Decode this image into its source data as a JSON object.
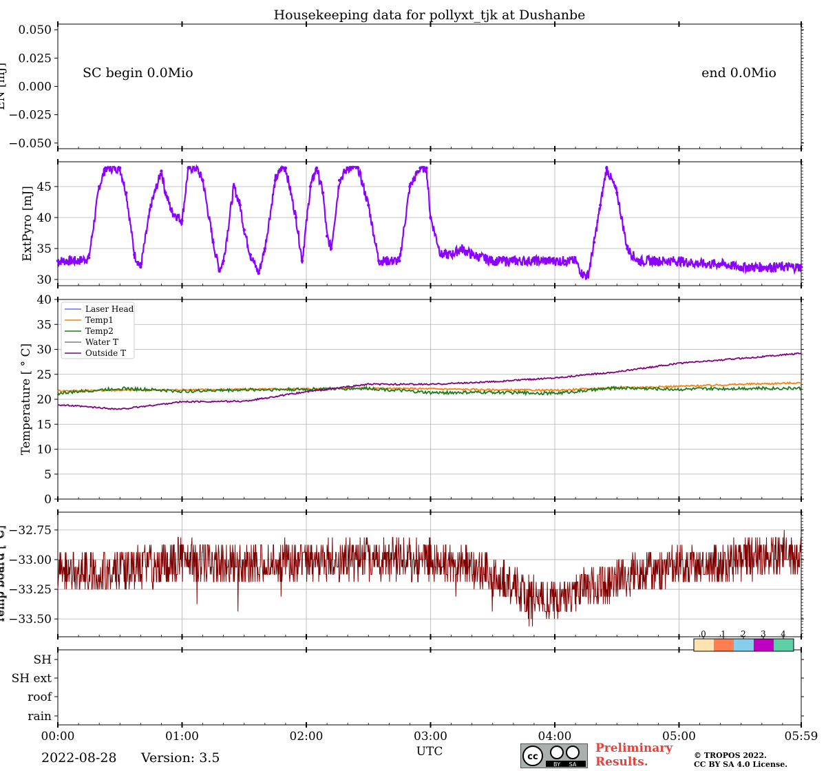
{
  "title": "Housekeeping data for pollyxt_tjk at Dushanbe",
  "date": "2022-08-28",
  "version": "Version: 3.5",
  "preliminary": [
    "Preliminary",
    "Results."
  ],
  "copyright": [
    "© TROPOS 2022.",
    "CC BY SA 4.0 License."
  ],
  "license_badge": {
    "by": "BY",
    "sa": "SA"
  },
  "xlabel": "UTC",
  "xticks": [
    "00:00",
    "01:00",
    "02:00",
    "03:00",
    "04:00",
    "05:00",
    "05:59"
  ],
  "colors": {
    "extpyro": "#8b00ff",
    "laser_head": "#6b6bff",
    "temp1": "#ff7f0e",
    "temp2": "#1a7d1a",
    "water_t": "#7f7f7f",
    "outside_t": "#800080",
    "tempboard": "#800000",
    "flag_colors": [
      "#fde3b0",
      "#ff7f50",
      "#87ceeb",
      "#c000c0",
      "#5fcfa6"
    ]
  },
  "chart_data": [
    {
      "type": "line",
      "name": "EN",
      "ylabel": "EN [mJ]",
      "ylim": [
        -0.055,
        0.055
      ],
      "yticks": [
        "0.050",
        "0.025",
        "0.000",
        "−0.025",
        "−0.050"
      ],
      "annotations": [
        "SC begin 0.0Mio",
        "end 0.0Mio"
      ],
      "series": []
    },
    {
      "type": "scatter",
      "name": "ExtPyro",
      "ylabel": "ExtPyro [mJ]",
      "ylim": [
        29,
        49
      ],
      "yticks": [
        "45",
        "40",
        "35",
        "30"
      ],
      "grid": true,
      "x_minutes": [
        0,
        10,
        15,
        20,
        23,
        30,
        33,
        37,
        40,
        45,
        50,
        52,
        55,
        60,
        63,
        67,
        70,
        75,
        78,
        80,
        85,
        88,
        90,
        93,
        97,
        100,
        105,
        108,
        110,
        115,
        118,
        122,
        125,
        128,
        130,
        132,
        136,
        140,
        145,
        150,
        155,
        158,
        162,
        165,
        170,
        175,
        178,
        180,
        185,
        190,
        195,
        200,
        210,
        220,
        230,
        235,
        240,
        245,
        250,
        253,
        256,
        259,
        262,
        265,
        270,
        275,
        280,
        290,
        300,
        310,
        320,
        330,
        340,
        350,
        359
      ],
      "values": [
        33,
        33,
        33.5,
        45,
        48,
        48,
        44,
        34,
        32,
        42,
        47.5,
        44,
        41,
        39.5,
        48,
        48,
        46,
        36,
        31.5,
        33,
        45,
        42,
        38,
        34,
        31,
        35,
        46,
        48,
        48,
        40,
        33,
        45,
        48,
        44,
        37,
        35,
        46,
        48,
        48,
        42,
        33,
        33,
        33,
        33,
        45,
        48,
        48,
        40,
        34,
        34,
        35,
        34,
        33,
        33,
        33,
        33,
        33,
        33,
        33,
        31,
        30.5,
        36,
        42,
        48,
        44,
        35,
        33,
        33,
        33,
        32.5,
        32.5,
        32,
        32,
        32,
        32
      ],
      "series": [
        {
          "name": "ExtPyro"
        }
      ]
    },
    {
      "type": "line",
      "name": "Temperature",
      "ylabel": "Temperature [$^\\circ C$]",
      "ylim": [
        0,
        40
      ],
      "yticks": [
        "0",
        "5",
        "10",
        "15",
        "20",
        "25",
        "30",
        "35",
        "40"
      ],
      "grid": true,
      "legend": "top-left",
      "x_minutes": [
        0,
        30,
        60,
        90,
        120,
        150,
        180,
        210,
        240,
        270,
        300,
        330,
        359
      ],
      "series": [
        {
          "name": "Laser Head",
          "values": []
        },
        {
          "name": "Temp1",
          "values": [
            21.7,
            21.8,
            21.9,
            22.0,
            22.1,
            22.2,
            22.1,
            21.9,
            21.8,
            22.3,
            22.6,
            23.0,
            23.3
          ]
        },
        {
          "name": "Temp2",
          "values": [
            21.2,
            22.2,
            21.6,
            21.9,
            22.0,
            22.2,
            21.3,
            21.4,
            21.2,
            22.3,
            22.0,
            22.2,
            22.2
          ]
        },
        {
          "name": "Water T",
          "values": []
        },
        {
          "name": "Outside T",
          "values": [
            18.9,
            18.0,
            19.5,
            19.6,
            21.5,
            23.0,
            23.0,
            23.5,
            24.3,
            25.5,
            27.2,
            28.2,
            29.2
          ]
        }
      ]
    },
    {
      "type": "line",
      "name": "TempBoard",
      "ylabel": "Temp board [°C]",
      "ylim": [
        -33.65,
        -32.6
      ],
      "yticks": [
        "−32.75",
        "−33.00",
        "−33.25",
        "−33.50"
      ],
      "grid": true,
      "x_minutes": [
        0,
        30,
        60,
        90,
        120,
        150,
        180,
        210,
        225,
        240,
        255,
        270,
        300,
        330,
        359
      ],
      "values": [
        -33.1,
        -33.1,
        -33.0,
        -33.05,
        -33.0,
        -33.0,
        -33.0,
        -33.1,
        -33.3,
        -33.35,
        -33.25,
        -33.15,
        -33.05,
        -33.0,
        -32.95
      ],
      "series": [
        {
          "name": "TempBoard"
        }
      ]
    },
    {
      "type": "heatmap",
      "name": "Flags",
      "yticks": [
        "SH",
        "SH ext",
        "roof",
        "rain"
      ],
      "colorbar_ticks": [
        "0",
        "1",
        "2",
        "3",
        "4"
      ]
    }
  ]
}
